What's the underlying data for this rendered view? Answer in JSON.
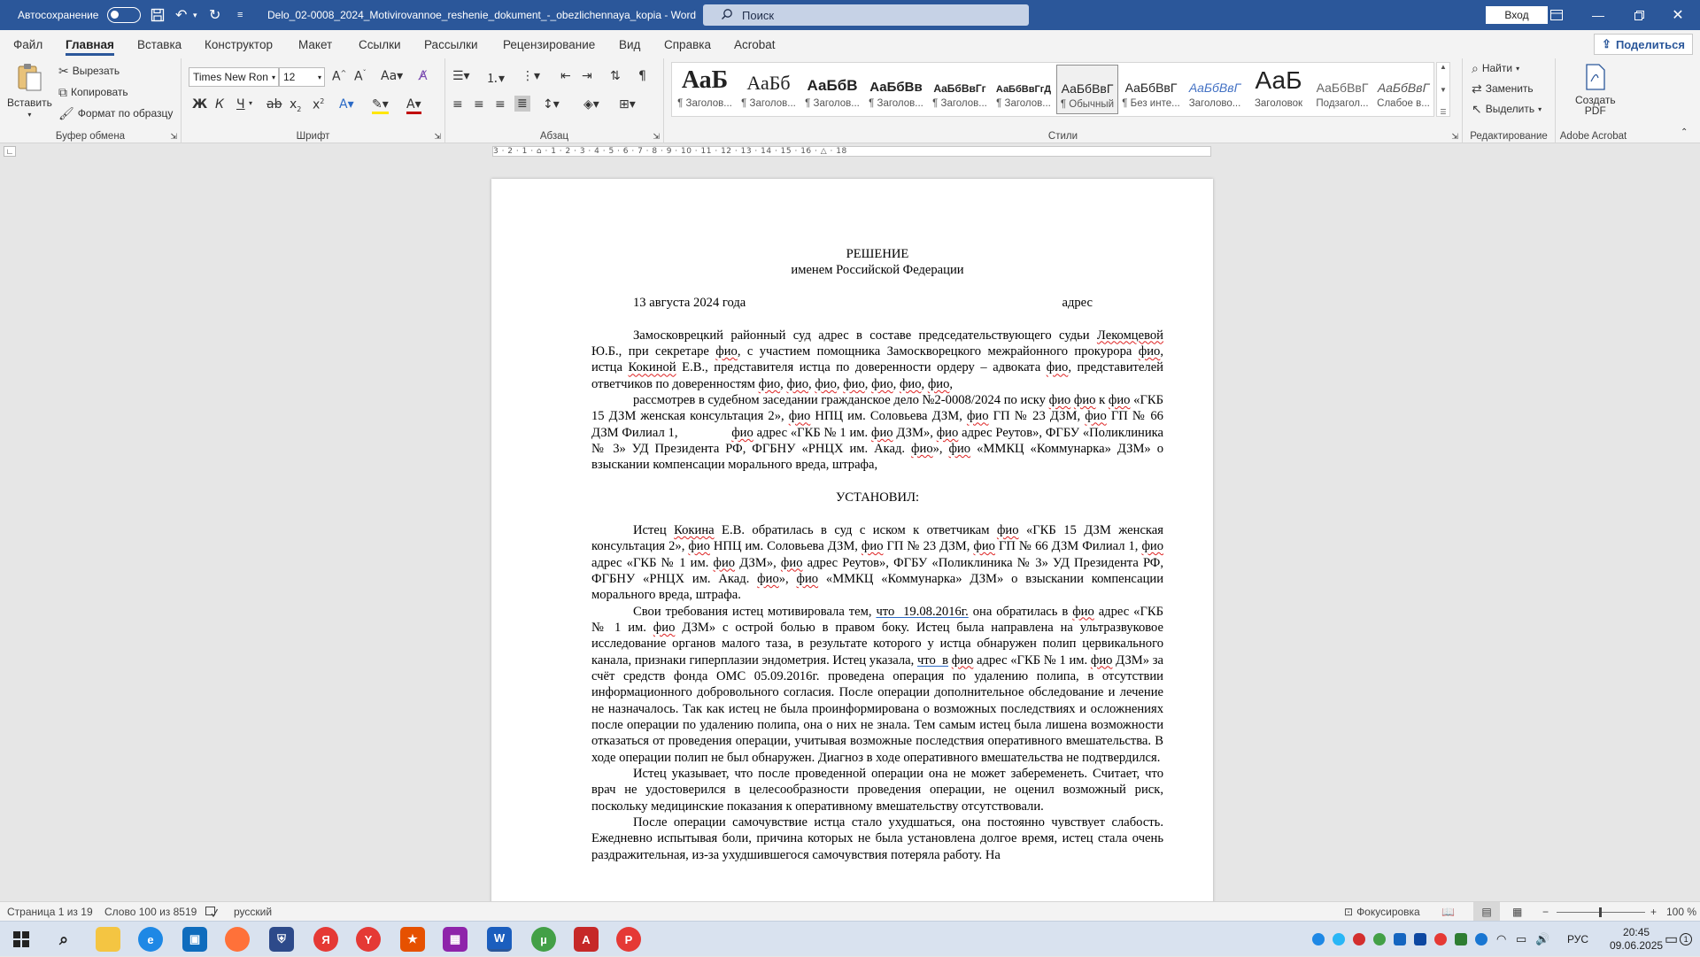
{
  "titlebar": {
    "autosave_label": "Автосохранение",
    "doc_title": "Delo_02-0008_2024_Motivirovannoe_reshenie_dokument_-_obezlichennaya_kopia  -  Word",
    "search_placeholder": "Поиск",
    "signin_label": "Вход"
  },
  "tabs": [
    {
      "label": "Файл"
    },
    {
      "label": "Главная"
    },
    {
      "label": "Вставка"
    },
    {
      "label": "Конструктор"
    },
    {
      "label": "Макет"
    },
    {
      "label": "Ссылки"
    },
    {
      "label": "Рассылки"
    },
    {
      "label": "Рецензирование"
    },
    {
      "label": "Вид"
    },
    {
      "label": "Справка"
    },
    {
      "label": "Acrobat"
    }
  ],
  "share_label": "Поделиться",
  "ribbon": {
    "clipboard": {
      "paste": "Вставить",
      "cut": "Вырезать",
      "copy": "Копировать",
      "format_painter": "Формат по образцу",
      "group": "Буфер обмена"
    },
    "font": {
      "family": "Times New Ron",
      "size": "12",
      "group": "Шрифт"
    },
    "paragraph": {
      "group": "Абзац"
    },
    "styles": {
      "group": "Стили",
      "items": [
        {
          "preview": "АаБ",
          "name": "¶ Заголов..."
        },
        {
          "preview": "АаБб",
          "name": "¶ Заголов..."
        },
        {
          "preview": "АаБбВ",
          "name": "¶ Заголов..."
        },
        {
          "preview": "АаБбВв",
          "name": "¶ Заголов..."
        },
        {
          "preview": "АаБбВвГг",
          "name": "¶ Заголов..."
        },
        {
          "preview": "АаБбВвГгД",
          "name": "¶ Заголов..."
        },
        {
          "preview": "АаБбВвГ",
          "name": "¶ Обычный"
        },
        {
          "preview": "АаБбВвГ",
          "name": "¶ Без инте..."
        },
        {
          "preview": "АаБбВвГ",
          "name": "Заголово..."
        },
        {
          "preview": "АаБ",
          "name": "Заголовок"
        },
        {
          "preview": "АаБбВвГ",
          "name": "Подзагол..."
        },
        {
          "preview": "АаБбВвГ",
          "name": "Слабое в..."
        }
      ]
    },
    "editing": {
      "find": "Найти",
      "replace": "Заменить",
      "select": "Выделить",
      "group": "Редактирование"
    },
    "adobe": {
      "create_pdf_line1": "Создать",
      "create_pdf_line2": "PDF",
      "group": "Adobe Acrobat"
    }
  },
  "ruler_text": "3 · 2 · 1 · ⌂ · 1 · 2 · 3 · 4 · 5 · 6 · 7 · 8 · 9 · 10 · 11 · 12 · 13 · 14 · 15 · 16 · △ · 18",
  "document": {
    "title": "РЕШЕНИЕ",
    "subtitle": "именем Российской Федерации",
    "date": "13 августа 2024 года",
    "place": "адрес",
    "p1": {
      "a": "Замосковрецкий районный суд адрес в составе председательствующего судьи ",
      "judge": "Лекомцевой",
      "b": " Ю.Б., при секретаре ",
      "f1": "фио",
      "c": ", с участием помощника Замоскворецкого межрайонного прокурора ",
      "f2": "фио",
      "d": ", истца ",
      "plaintiff": "Кокиной",
      "e": " Е.В., представителя истца по доверенности ордеру – адвоката ",
      "f3": "фио",
      "f": ", представителей ответчиков по доверенностям ",
      "f4": "фио",
      "g": ", ",
      "f5": "фио",
      "h": ", ",
      "f6": "фио",
      "i": ", ",
      "f7": "фио",
      "j": ", ",
      "f8": "фио",
      "k": ", ",
      "f9": "фио",
      "l": ", ",
      "f10": "фио",
      "m": ","
    },
    "p2": {
      "a": "рассмотрев в судебном заседании гражданское дело №2-0008/2024 по иску ",
      "f1": "фио",
      "sp": " ",
      "f2": "фио",
      "b": " к ",
      "f3": "фио",
      "c": " «ГКБ 15 ДЗМ женская консультация 2», ",
      "f4": "фио",
      "d": " НПЦ им. Соловьева ДЗМ, ",
      "f5": "фио",
      "e": " ГП № 23 ДЗМ, ",
      "f6": "фио",
      "f": " ГП № 66 ДЗМ Филиал 1,                ",
      "f7": "фио",
      "g": " адрес «ГКБ № 1 им. ",
      "f8": "фио",
      "h": " ДЗМ», ",
      "f9": "фио",
      "i": " адрес Реутов», ФГБУ «Поликлиника № 3» УД Президента РФ, ФГБНУ «РНЦХ им. Акад. ",
      "f10": "фио",
      "j": "», ",
      "f11": "фио",
      "k": " «ММКЦ «Коммунарка» ДЗМ» о взыскании компенсации морального вреда, штрафа,"
    },
    "established": "УСТАНОВИЛ:",
    "p3": {
      "a": "Истец ",
      "plaintiff": "Кокина",
      "b": " Е.В. обратилась в суд с иском к ответчикам ",
      "f1": "фио",
      "c": " «ГКБ 15 ДЗМ женская консультация 2», ",
      "f2": "фио",
      "d": " НПЦ им. Соловьева ДЗМ, ",
      "f3": "фио",
      "e": " ГП № 23 ДЗМ, ",
      "f4": "фио",
      "f": " ГП № 66 ДЗМ Филиал 1, ",
      "f5": "фио",
      "g": " адрес «ГКБ № 1 им. ",
      "f6": "фио",
      "h": " ДЗМ», ",
      "f7": "фио",
      "i": " адрес Реутов», ФГБУ «Поликлиника № 3» УД Президента РФ, ФГБНУ «РНЦХ им. Акад. ",
      "f8": "фио",
      "j": "», ",
      "f9": "фио",
      "k": " «ММКЦ «Коммунарка» ДЗМ» о взыскании компенсации морального вреда, штрафа."
    },
    "p4": {
      "a": "Свои требования истец мотивировала тем, ",
      "u1": "что  19.08.2016г.",
      "b": " она обратилась в ",
      "f1": "фио",
      "c": " адрес «ГКБ № 1 им. ",
      "f2": "фио",
      "d": " ДЗМ» с острой болью в правом боку. Истец была направлена на ультразвуковое исследование органов малого таза, в результате которого у истца обнаружен полип цервикального канала, признаки гиперплазии эндометрия. Истец указала, ",
      "u2": "что  в",
      "sp": " ",
      "f3": "фио",
      "e": " адрес «ГКБ № 1 им. ",
      "f4": "фио",
      "f": " ДЗМ» за счёт средств фонда ОМС 05.09.2016г. проведена операция по удалению полипа, в отсутствии информационного добровольного согласия. После операции дополнительное обследование и лечение не назначалось. Так как истец не была проинформирована о возможных последствиях и осложнениях после операции по удалению полипа, она о них не знала. Тем самым истец была лишена возможности отказаться от проведения операции, учитывая возможные последствия оперативного вмешательства. В ходе операции полип не был обнаружен. Диагноз в ходе оперативного вмешательства не подтвердился."
    },
    "p5": "Истец указывает, что после проведенной операции она не может забеременеть. Считает, что врач не удостоверился в целесообразности проведения операции, не оценил возможный риск, поскольку медицинские показания к оперативному вмешательству отсутствовали.",
    "p6": "После операции самочувствие истца стало ухудшаться, она постоянно чувствует слабость. Ежедневно испытывая боли, причина которых не была установлена долгое время, истец стала очень раздражительная, из-за ухудшившегося самочувствия потеряла работу. На"
  },
  "status": {
    "page": "Страница 1 из 19",
    "words": "Слово 100 из 8519",
    "language": "русский",
    "focus": "Фокусировка",
    "zoom": "100 %"
  },
  "taskbar": {
    "lang": "РУС",
    "time": "20:45",
    "date": "09.06.2025",
    "notif": "1"
  },
  "colors": {
    "titlebar": "#2b579a",
    "accent": "#2b579a",
    "spell_error": "#d22222"
  }
}
